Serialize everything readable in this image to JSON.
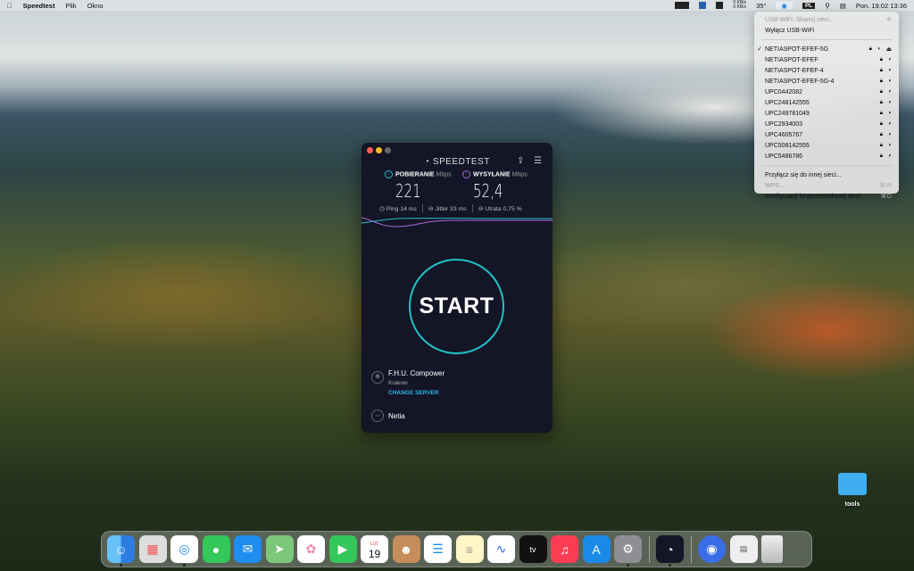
{
  "menubar": {
    "app": "Speedtest",
    "items": [
      "Plik",
      "Okno"
    ],
    "temp": "35°",
    "net_up": "0 KB/s",
    "net_down": "0 KB/s",
    "input_source": "PL",
    "datetime": "Pon. 19.02  13:36"
  },
  "wifi_menu": {
    "scan": "USB-WiFi: Skanuj sieci...",
    "toggle": "Wyłącz USB-WiFi",
    "networks": [
      {
        "name": "NETIASPOT-EFEF-5G",
        "connected": true
      },
      {
        "name": "NETIASPOT-EFEF"
      },
      {
        "name": "NETIASPOT-EFEF-4"
      },
      {
        "name": "NETIASPOT-EFEF-5G-4"
      },
      {
        "name": "UPC0442082"
      },
      {
        "name": "UPC248142555"
      },
      {
        "name": "UPC249781049"
      },
      {
        "name": "UPC2934003"
      },
      {
        "name": "UPC4605767"
      },
      {
        "name": "UPC508142555"
      },
      {
        "name": "UPC5486786"
      }
    ],
    "join_other": "Przyłącz się do innej sieci...",
    "wps": "WPS...",
    "wps_shortcut": "⌘W",
    "config": "Konfiguracji bezprzewodowej sieci...",
    "config_shortcut": "⌘O"
  },
  "speedtest": {
    "title": "SPEEDTEST",
    "download_label": "POBIERANIE",
    "upload_label": "WYSYŁANIE",
    "unit": "Mbps",
    "download": "221",
    "upload": "52,4",
    "ping": "Ping 14 ms",
    "jitter": "Jitter 33 ms",
    "loss": "Utrata 0,75 %",
    "start": "START",
    "server_name": "F.H.U. Compower",
    "server_city": "Krakow",
    "change_server": "CHANGE SERVER",
    "isp": "Netia",
    "accent": "#1fc3c4",
    "upload_color": "#a46fd8"
  },
  "dock": {
    "calendar_month": "LUT",
    "calendar_day": "19",
    "tv": "tv"
  },
  "desktop": {
    "folder": "tools"
  }
}
